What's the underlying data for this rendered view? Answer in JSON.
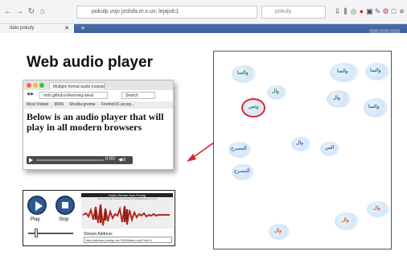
{
  "browser": {
    "url": "pokulp vojv jzolsfa.m.x.ux; lejajulc1",
    "search_placeholder": "pokuly",
    "tab_title": "dalo pokuly",
    "nav": {
      "back": "←",
      "forward": "→",
      "reload": "↻",
      "home": "⌂"
    },
    "toolbar_icons": [
      "download-icon",
      "library-icon",
      "sync-icon",
      "block-icon",
      "screenshot-icon",
      "addon-icon",
      "gear-icon",
      "extension-icon",
      "menu-icon"
    ],
    "toolbar_glyphs": [
      "⇩",
      "⫼",
      "◎",
      "●",
      "▣",
      "✎",
      "⚙",
      "□",
      "≡"
    ],
    "new_tab": "+",
    "tab_close": "✕",
    "colors": {
      "tabstrip": "#3a5f9c",
      "accent_red": "#e0242b",
      "accent_blue": "#2d5a8f"
    }
  },
  "slide": {
    "title": "Web audio player",
    "mini_browser": {
      "tab_title": "Multiple format audio example",
      "url": "mdn.github.io/learning-area/",
      "search": "Search",
      "bookmarks": [
        "Most Visited",
        "MDN",
        "Mozilla gnome",
        "FirefoxOS accep..."
      ],
      "heading": "Below is an audio player that will play in all modern browsers",
      "time": "0:00",
      "volume_icon": "◀ııl"
    },
    "stream_app": {
      "play_label": "Play",
      "stop_label": "Stop",
      "panel_title": "Audio Stream from Prosig",
      "panel_subtitle": "streaming http://stream.prosig.net:7844/stream/?cmd=1",
      "stream_address_label": "Stream Address",
      "stream_address_value": "http://stream.prosig.net:7844/listen.mp3?sid=1"
    },
    "map": {
      "highlighted_cluster": "وتس",
      "clusters": [
        {
          "label": "والسا",
          "color": "#2c7b3a"
        },
        {
          "label": "وتس",
          "color": "#2c7b3a"
        },
        {
          "label": "وال",
          "color": "#2c7b3a"
        },
        {
          "label": "والسا",
          "color": "#1f6e8a"
        },
        {
          "label": "والسا",
          "color": "#1f6e8a"
        },
        {
          "label": "وال",
          "color": "#1f6e8a"
        },
        {
          "label": "المسرح",
          "color": "#3a6fb0"
        },
        {
          "label": "المسرح",
          "color": "#3a6fb0"
        },
        {
          "label": "وال",
          "color": "#5c4ba0"
        },
        {
          "label": "الس",
          "color": "#5c4ba0"
        },
        {
          "label": "والسا",
          "color": "#1f6e8a"
        },
        {
          "label": "وال",
          "color": "#c0572a"
        },
        {
          "label": "وال",
          "color": "#c0572a"
        },
        {
          "label": "وال",
          "color": "#c0572a"
        }
      ]
    }
  }
}
